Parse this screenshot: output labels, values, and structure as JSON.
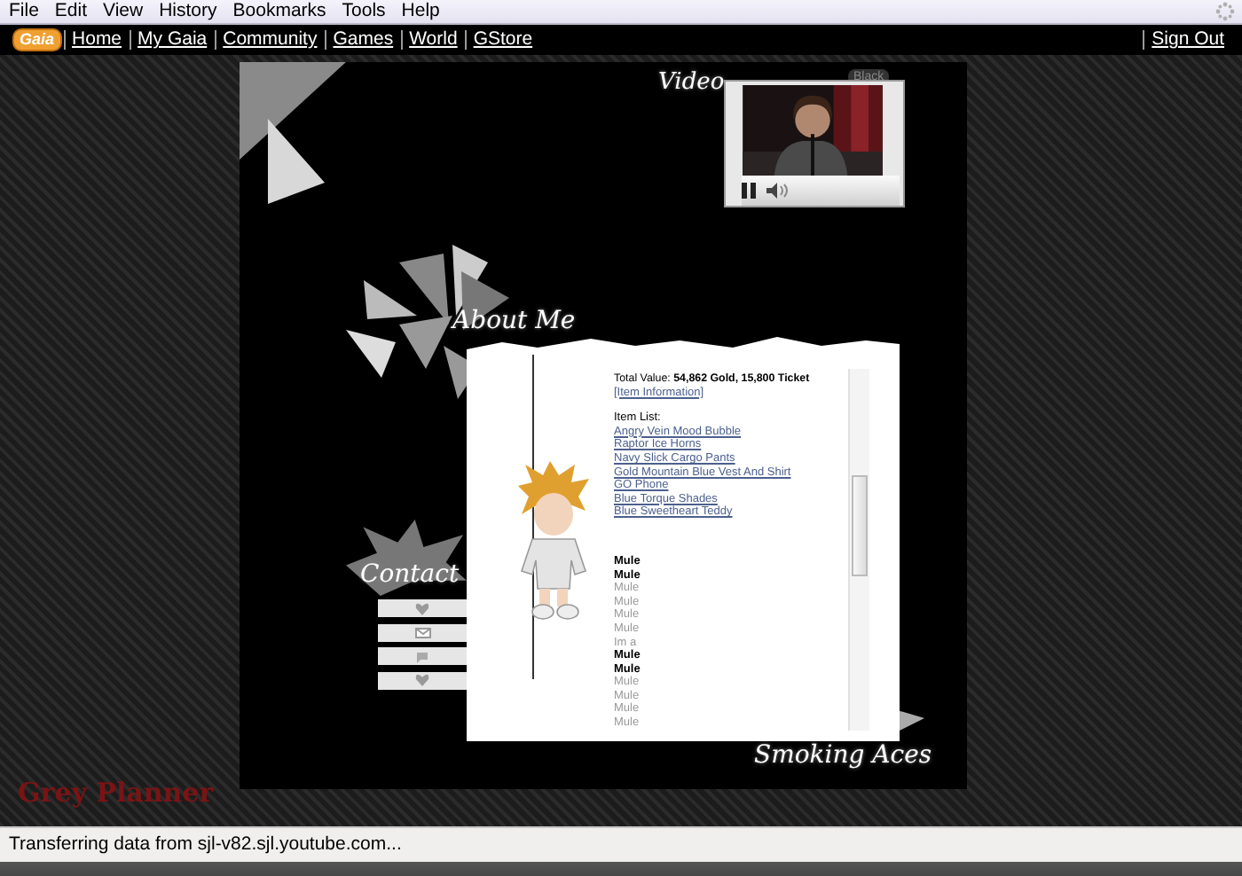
{
  "menu_bar": {
    "items": [
      "File",
      "Edit",
      "View",
      "History",
      "Bookmarks",
      "Tools",
      "Help"
    ]
  },
  "nav_bar": {
    "logo": "Gaia",
    "links": [
      "Home",
      "My Gaia",
      "Community",
      "Games",
      "World",
      "GStore"
    ],
    "sign_out": "Sign Out"
  },
  "profile": {
    "video": {
      "title": "Video",
      "toggle": "Black",
      "playing": true
    },
    "about": {
      "title": "About Me",
      "total_value": "Total Value: **54,862 Gold, 15,800 Ticket**",
      "info_link": "[Item Information]",
      "list_heading": "Item List:",
      "items": [
        "Angry Vein Mood Bubble",
        "Raptor Ice Horns",
        "Navy Slick Cargo Pants",
        "Gold Mountain Blue Vest And Shirt",
        "GO Phone",
        "Blue Torque Shades",
        "Blue Sweetheart Teddy"
      ],
      "lines": [
        {
          "text": "Mule",
          "bold": true
        },
        {
          "text": "Mule",
          "bold": true
        },
        {
          "text": "Mule",
          "bold": false
        },
        {
          "text": "Mule",
          "bold": false
        },
        {
          "text": "Mule",
          "bold": false
        },
        {
          "text": "Mule",
          "bold": false
        },
        {
          "text": "Im a",
          "bold": false
        },
        {
          "text": "Mule",
          "bold": true
        },
        {
          "text": "Mule",
          "bold": true
        },
        {
          "text": "Mule",
          "bold": false
        },
        {
          "text": "Mule",
          "bold": false
        },
        {
          "text": "Mule",
          "bold": false
        },
        {
          "text": "Mule",
          "bold": false
        }
      ]
    },
    "contact": {
      "title": "Contact",
      "buttons": [
        {
          "kind": "heart"
        },
        {
          "kind": "mail"
        },
        {
          "kind": "chat"
        },
        {
          "kind": "heart"
        }
      ]
    },
    "footer_title": "Smoking Aces",
    "site_title": "Grey Planner"
  },
  "status_bar": {
    "text": "Transferring data from sjl-v82.sjl.youtube.com..."
  }
}
